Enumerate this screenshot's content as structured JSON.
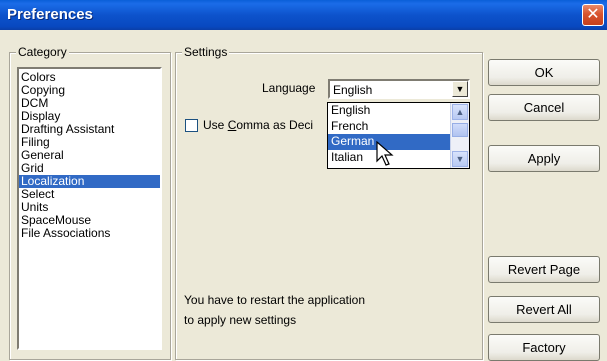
{
  "window": {
    "title": "Preferences",
    "close_glyph": "✕"
  },
  "category": {
    "legend": "Category",
    "items": [
      {
        "label": "Colors"
      },
      {
        "label": "Copying"
      },
      {
        "label": "DCM"
      },
      {
        "label": "Display"
      },
      {
        "label": "Drafting Assistant"
      },
      {
        "label": "Filing"
      },
      {
        "label": "General"
      },
      {
        "label": "Grid"
      },
      {
        "label": "Localization",
        "selected": true
      },
      {
        "label": "Select"
      },
      {
        "label": "Units"
      },
      {
        "label": "SpaceMouse"
      },
      {
        "label": "File Associations"
      }
    ]
  },
  "settings": {
    "legend": "Settings",
    "language_label": "Language",
    "language_value": "English",
    "language_options": [
      {
        "label": "English"
      },
      {
        "label": "French"
      },
      {
        "label": "German",
        "selected": true
      },
      {
        "label": "Italian"
      }
    ],
    "comma_label_prefix": "Use ",
    "comma_label_accel": "C",
    "comma_label_rest": "omma as Deci",
    "comma_checked": false,
    "restart_line1": "You have to restart the application",
    "restart_line2": "to apply new settings"
  },
  "buttons": {
    "ok": "OK",
    "cancel": "Cancel",
    "apply": "Apply",
    "revert_page": "Revert Page",
    "revert_all": "Revert All",
    "factory": "Factory"
  },
  "colors": {
    "title_bar": "#0a5fd8",
    "selection": "#316ac5",
    "close_button": "#d8542e"
  }
}
